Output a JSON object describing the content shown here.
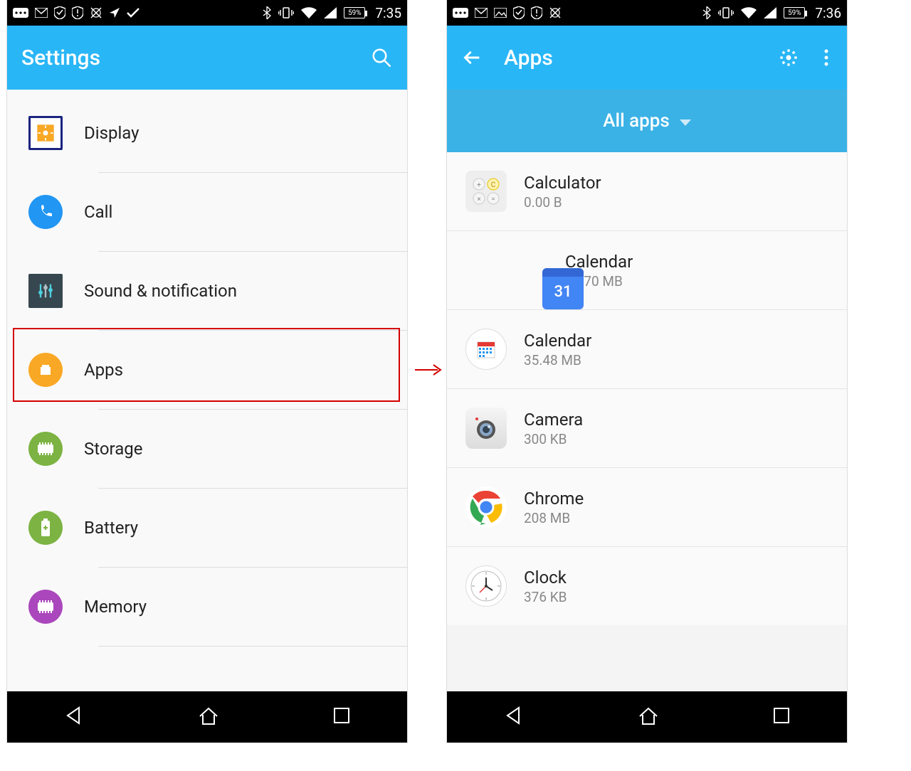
{
  "statusbar_left": {
    "battery_pct": "59%",
    "time": "7:35"
  },
  "statusbar_right": {
    "battery_pct": "59%",
    "time": "7:36"
  },
  "left_screen": {
    "title": "Settings",
    "items": [
      {
        "label": "Display"
      },
      {
        "label": "Call"
      },
      {
        "label": "Sound & notification"
      },
      {
        "label": "Apps"
      },
      {
        "label": "Storage"
      },
      {
        "label": "Battery"
      },
      {
        "label": "Memory"
      }
    ]
  },
  "right_screen": {
    "title": "Apps",
    "filter_label": "All apps",
    "apps": [
      {
        "name": "Calculator",
        "size": "0.00 B"
      },
      {
        "name": "Calendar",
        "size": "46.70 MB"
      },
      {
        "name": "Calendar",
        "size": "35.48 MB"
      },
      {
        "name": "Camera",
        "size": "300 KB"
      },
      {
        "name": "Chrome",
        "size": "208 MB"
      },
      {
        "name": "Clock",
        "size": "376 KB"
      }
    ]
  }
}
